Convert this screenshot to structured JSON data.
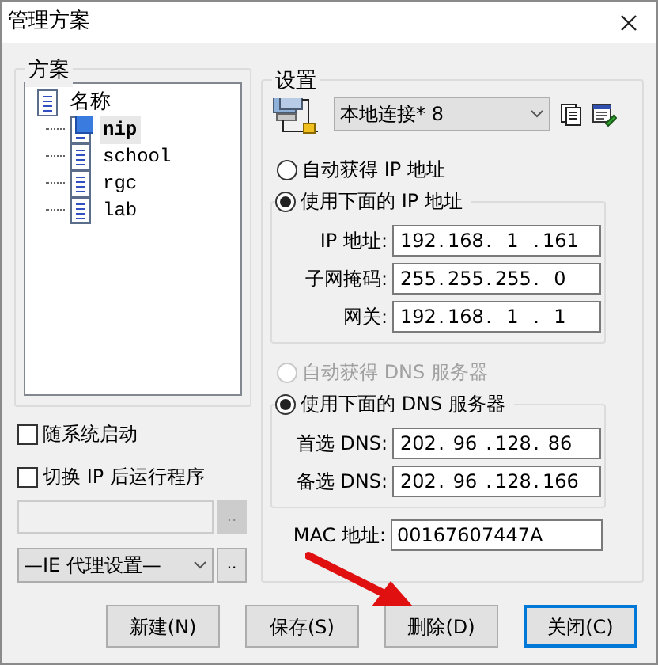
{
  "window": {
    "title": "管理方案"
  },
  "schemes": {
    "group_label": "方案",
    "tree": {
      "label": "名称",
      "children": [
        {
          "label": "nip",
          "selected": true
        },
        {
          "label": "school",
          "selected": false
        },
        {
          "label": "rgc",
          "selected": false
        },
        {
          "label": "lab",
          "selected": false
        }
      ]
    }
  },
  "options": {
    "checkboxes": [
      {
        "label": "随系统启动",
        "checked": false
      },
      {
        "label": "切换 IP 后运行程序",
        "checked": false
      }
    ],
    "program_field": {
      "disabled": true,
      "browse_label": ".."
    },
    "proxy_select": {
      "value": "—IE 代理设置—",
      "browse_label": ".."
    }
  },
  "settings": {
    "group_label": "设置",
    "connection_select": {
      "value": "本地连接* 8"
    },
    "separator": ".",
    "ip": {
      "auto": {
        "label": "自动获得 IP 地址",
        "selected": false,
        "disabled": false
      },
      "manual": {
        "label": "使用下面的 IP 地址",
        "selected": true,
        "disabled": false
      },
      "fields": [
        {
          "label": "IP 地址:",
          "octets": [
            "192",
            "168",
            "1",
            "161"
          ]
        },
        {
          "label": "子网掩码:",
          "octets": [
            "255",
            "255",
            "255",
            "0"
          ]
        },
        {
          "label": "网关:",
          "octets": [
            "192",
            "168",
            "1",
            "1"
          ]
        }
      ]
    },
    "dns": {
      "auto": {
        "label": "自动获得 DNS 服务器",
        "selected": false,
        "disabled": true
      },
      "manual": {
        "label": "使用下面的 DNS 服务器",
        "selected": true,
        "disabled": false
      },
      "fields": [
        {
          "label": "首选 DNS:",
          "octets": [
            "202",
            "96",
            "128",
            "86"
          ]
        },
        {
          "label": "备选 DNS:",
          "octets": [
            "202",
            "96",
            "128",
            "166"
          ]
        }
      ]
    },
    "mac": {
      "label": "MAC 地址:",
      "value": "00167607447A"
    }
  },
  "buttons": [
    {
      "label": "新建(N)",
      "focused": false
    },
    {
      "label": "保存(S)",
      "focused": false
    },
    {
      "label": "删除(D)",
      "focused": false
    },
    {
      "label": "关闭(C)",
      "focused": true
    }
  ]
}
